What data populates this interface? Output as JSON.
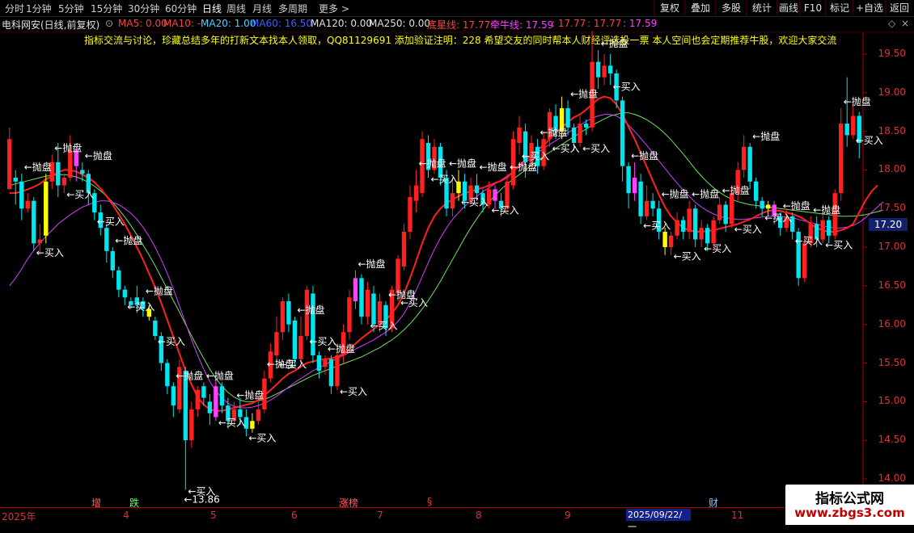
{
  "toolbar": {
    "timeframes": [
      "分时",
      "1分钟",
      "5分钟",
      "15分钟",
      "30分钟",
      "60分钟",
      "日线",
      "周线",
      "月线",
      "多周期",
      "更多 >"
    ],
    "active": "日线",
    "buttons": [
      "复权",
      "叠加",
      "多股",
      "统计",
      "画线",
      "F10",
      "标记",
      "+自选",
      "返回"
    ]
  },
  "stock": {
    "name": "电科网安(日线,前复权)",
    "indicators": [
      {
        "label": "MA5: 0.00",
        "color": "#ff4040"
      },
      {
        "label": "MA10: -",
        "color": "#ff4040"
      },
      {
        "label": "MA20: 1.00",
        "color": "#50d0ff"
      },
      {
        "label": "MA60: 16.50",
        "color": "#4060ff"
      },
      {
        "label": "MA120: 0.00",
        "color": "#e0e0e0"
      },
      {
        "label": "MA250: 0.00",
        "color": "#e0e0e0"
      },
      {
        "label": "底星线: 17.77",
        "color": "#ff4040"
      },
      {
        "label": "牵牛线: 17.59",
        "color": "#ff40ff"
      },
      {
        "label": ": 17.77",
        "color": "#ff4040"
      },
      {
        "label": ": 17.77",
        "color": "#ff4040"
      },
      {
        "label": ": 17.59",
        "color": "#ff40ff"
      }
    ]
  },
  "notice": "指标交流与讨论，珍藏总结多年的打新文本找本人领取，QQ81129691 添加验证注明：228 希望交友的同时帮本人财经评选投一票      本人空间也会定期推荐牛股，欢迎大家交流",
  "price_axis": {
    "labels": [
      "19.50",
      "19.00",
      "18.50",
      "18.00",
      "17.50",
      "17.00",
      "16.50",
      "16.00",
      "15.50",
      "15.00",
      "14.50",
      "14.00"
    ],
    "current": "17.20",
    "low_label": "13.86"
  },
  "dates": [
    "2025年",
    "4",
    "5",
    "6",
    "7",
    "8",
    "9",
    "11"
  ],
  "date_highlight": "2025/09/22/一",
  "events": [
    {
      "label": "增",
      "color": "#ff6060"
    },
    {
      "label": "跌",
      "color": "#60ff60"
    },
    {
      "label": "涨榜",
      "color": "#ff6060"
    },
    {
      "label": "§",
      "color": "#ff3030"
    },
    {
      "label": "财",
      "color": "#80c0ff"
    }
  ],
  "signals": {
    "sell": "←抛盘",
    "buy": "←买入"
  },
  "watermark": {
    "title": "指标公式网",
    "url": "www.zbgs3.com"
  },
  "colors": {
    "up": "#ff2020",
    "down": "#00e5ee",
    "buy_candle": "#ffff00",
    "sell_candle": "#ff40ff",
    "ma_short": "#ff2020",
    "ma_mid": "#d040ff",
    "ma_long": "#70e060"
  },
  "chart_data": {
    "type": "candlestick",
    "ylim": [
      13.7,
      19.8
    ],
    "candles": [
      [
        17.75,
        18.4,
        17.9,
        18.55
      ],
      [
        17.9,
        17.85,
        17.55,
        18.0
      ],
      [
        17.85,
        17.5,
        17.35,
        17.95
      ],
      [
        17.5,
        17.6,
        17.45,
        17.7
      ],
      [
        17.6,
        17.05,
        16.95,
        17.65
      ],
      [
        17.05,
        17.1,
        16.9,
        17.3
      ],
      [
        17.15,
        17.85,
        17.05,
        17.95
      ],
      [
        17.85,
        18.1,
        17.75,
        18.2
      ],
      [
        18.1,
        17.8,
        17.65,
        18.35
      ],
      [
        17.8,
        17.9,
        17.7,
        17.95
      ],
      [
        17.9,
        18.25,
        17.85,
        18.45
      ],
      [
        18.25,
        18.05,
        17.85,
        18.3
      ],
      [
        18.0,
        17.95,
        17.85,
        18.1
      ],
      [
        17.95,
        17.7,
        17.55,
        18.0
      ],
      [
        17.7,
        17.45,
        17.35,
        17.75
      ],
      [
        17.45,
        17.25,
        17.15,
        17.55
      ],
      [
        17.25,
        16.95,
        16.8,
        17.3
      ],
      [
        16.95,
        16.7,
        16.6,
        17.0
      ],
      [
        16.7,
        16.45,
        16.35,
        16.75
      ],
      [
        16.45,
        16.35,
        16.25,
        16.5
      ],
      [
        16.3,
        16.25,
        16.2,
        16.35
      ],
      [
        16.35,
        16.25,
        16.15,
        16.5
      ],
      [
        16.3,
        16.2,
        16.1,
        16.35
      ],
      [
        16.2,
        16.1,
        16.05,
        16.25
      ],
      [
        16.05,
        15.85,
        15.8,
        16.1
      ],
      [
        15.85,
        15.5,
        15.4,
        15.9
      ],
      [
        15.5,
        15.2,
        15.1,
        15.55
      ],
      [
        15.2,
        14.95,
        14.8,
        15.25
      ],
      [
        14.9,
        15.45,
        14.85,
        15.55
      ],
      [
        15.4,
        14.5,
        13.86,
        15.45
      ],
      [
        14.5,
        14.9,
        14.4,
        15.0
      ],
      [
        14.9,
        15.15,
        14.8,
        15.2
      ],
      [
        15.2,
        15.05,
        14.95,
        15.25
      ],
      [
        15.0,
        14.85,
        14.7,
        15.1
      ],
      [
        14.8,
        15.2,
        14.75,
        15.3
      ],
      [
        15.2,
        14.95,
        14.85,
        15.25
      ],
      [
        14.95,
        14.75,
        14.65,
        15.05
      ],
      [
        14.75,
        14.9,
        14.7,
        15.0
      ],
      [
        14.9,
        14.8,
        14.7,
        15.05
      ],
      [
        14.8,
        14.65,
        14.55,
        14.9
      ],
      [
        14.65,
        14.75,
        14.6,
        14.85
      ],
      [
        14.75,
        14.9,
        14.7,
        15.0
      ],
      [
        14.9,
        15.3,
        14.85,
        15.4
      ],
      [
        15.3,
        15.65,
        15.25,
        15.75
      ],
      [
        15.6,
        15.9,
        15.5,
        16.1
      ],
      [
        15.9,
        16.3,
        15.8,
        16.35
      ],
      [
        16.3,
        16.0,
        15.9,
        16.4
      ],
      [
        16.05,
        15.55,
        15.45,
        16.1
      ],
      [
        15.55,
        15.85,
        15.5,
        16.1
      ],
      [
        15.85,
        16.45,
        15.8,
        16.5
      ],
      [
        16.4,
        15.6,
        15.5,
        16.5
      ],
      [
        15.6,
        15.4,
        15.3,
        15.65
      ],
      [
        15.45,
        15.55,
        15.35,
        15.6
      ],
      [
        15.55,
        15.2,
        15.1,
        15.6
      ],
      [
        15.2,
        15.6,
        15.15,
        15.65
      ],
      [
        15.6,
        15.9,
        15.5,
        16.0
      ],
      [
        15.9,
        16.35,
        15.8,
        16.45
      ],
      [
        16.3,
        16.6,
        16.2,
        16.7
      ],
      [
        16.6,
        16.1,
        16.0,
        16.65
      ],
      [
        16.1,
        16.45,
        16.0,
        16.55
      ],
      [
        16.4,
        16.0,
        15.9,
        16.5
      ],
      [
        16.0,
        16.3,
        15.9,
        16.4
      ],
      [
        16.25,
        15.95,
        15.85,
        16.3
      ],
      [
        15.95,
        16.45,
        15.9,
        16.5
      ],
      [
        16.4,
        16.85,
        16.3,
        16.9
      ],
      [
        16.75,
        17.2,
        16.7,
        17.3
      ],
      [
        17.2,
        17.65,
        17.1,
        17.8
      ],
      [
        17.6,
        17.8,
        17.45,
        18.0
      ],
      [
        17.7,
        18.4,
        17.65,
        18.5
      ],
      [
        18.35,
        18.0,
        17.9,
        18.45
      ],
      [
        18.0,
        18.3,
        17.95,
        18.4
      ],
      [
        18.3,
        17.9,
        17.8,
        18.35
      ],
      [
        17.9,
        17.5,
        17.4,
        18.0
      ],
      [
        17.5,
        17.7,
        17.4,
        17.9
      ],
      [
        17.7,
        17.85,
        17.6,
        18.0
      ],
      [
        17.85,
        17.6,
        17.5,
        17.95
      ],
      [
        17.6,
        17.8,
        17.55,
        17.9
      ],
      [
        17.8,
        17.7,
        17.6,
        17.95
      ],
      [
        17.7,
        17.55,
        17.45,
        17.75
      ],
      [
        17.55,
        17.75,
        17.5,
        17.85
      ],
      [
        17.75,
        17.6,
        17.5,
        17.8
      ],
      [
        17.6,
        17.5,
        17.4,
        17.7
      ],
      [
        17.5,
        17.85,
        17.45,
        17.95
      ],
      [
        17.8,
        18.4,
        17.75,
        18.5
      ],
      [
        18.35,
        18.55,
        18.2,
        18.7
      ],
      [
        18.5,
        18.1,
        17.9,
        18.6
      ],
      [
        18.1,
        18.35,
        18.0,
        18.45
      ],
      [
        18.3,
        18.05,
        17.95,
        18.4
      ],
      [
        18.05,
        18.4,
        18.0,
        18.5
      ],
      [
        18.4,
        18.75,
        18.3,
        18.8
      ],
      [
        18.7,
        18.5,
        18.4,
        18.85
      ],
      [
        18.5,
        18.8,
        18.4,
        18.95
      ],
      [
        18.8,
        18.55,
        18.45,
        18.9
      ],
      [
        18.55,
        18.35,
        18.25,
        18.6
      ],
      [
        18.35,
        18.6,
        18.3,
        18.7
      ],
      [
        18.6,
        18.55,
        18.45,
        18.65
      ],
      [
        18.55,
        19.4,
        18.5,
        19.8
      ],
      [
        19.4,
        19.2,
        19.05,
        19.55
      ],
      [
        19.2,
        19.35,
        19.1,
        19.5
      ],
      [
        19.35,
        19.25,
        19.1,
        19.5
      ],
      [
        19.25,
        18.9,
        18.8,
        19.3
      ],
      [
        18.9,
        18.05,
        17.85,
        18.95
      ],
      [
        18.05,
        17.7,
        17.5,
        18.1
      ],
      [
        17.7,
        17.9,
        17.6,
        18.1
      ],
      [
        17.85,
        17.4,
        17.3,
        17.95
      ],
      [
        17.4,
        17.6,
        17.35,
        17.8
      ],
      [
        17.6,
        17.5,
        17.4,
        17.7
      ],
      [
        17.5,
        17.2,
        17.1,
        17.6
      ],
      [
        17.2,
        17.0,
        16.9,
        17.25
      ],
      [
        17.0,
        17.15,
        16.9,
        17.2
      ],
      [
        17.15,
        17.35,
        17.1,
        17.45
      ],
      [
        17.35,
        17.2,
        17.1,
        17.4
      ],
      [
        17.2,
        17.5,
        17.1,
        17.6
      ],
      [
        17.5,
        17.1,
        17.0,
        17.55
      ],
      [
        17.1,
        17.25,
        17.0,
        17.35
      ],
      [
        17.25,
        17.05,
        16.95,
        17.3
      ],
      [
        17.05,
        17.35,
        17.0,
        17.4
      ],
      [
        17.35,
        17.55,
        17.3,
        17.65
      ],
      [
        17.55,
        17.3,
        17.2,
        17.6
      ],
      [
        17.3,
        17.7,
        17.25,
        17.8
      ],
      [
        17.7,
        18.0,
        17.6,
        18.1
      ],
      [
        18.0,
        18.3,
        17.9,
        18.45
      ],
      [
        18.3,
        17.85,
        17.75,
        18.35
      ],
      [
        17.85,
        17.6,
        17.5,
        17.9
      ],
      [
        17.6,
        17.5,
        17.4,
        17.65
      ],
      [
        17.5,
        17.55,
        17.4,
        17.6
      ],
      [
        17.55,
        17.4,
        17.3,
        17.6
      ],
      [
        17.4,
        17.25,
        17.15,
        17.45
      ],
      [
        17.25,
        17.4,
        17.2,
        17.5
      ],
      [
        17.4,
        17.2,
        17.1,
        17.45
      ],
      [
        17.2,
        16.6,
        16.5,
        17.25
      ],
      [
        16.6,
        17.05,
        16.55,
        17.15
      ],
      [
        17.05,
        17.3,
        17.0,
        17.4
      ],
      [
        17.3,
        17.1,
        17.0,
        17.4
      ],
      [
        17.1,
        17.35,
        17.05,
        17.45
      ],
      [
        17.35,
        17.15,
        17.05,
        17.4
      ],
      [
        17.15,
        17.7,
        17.1,
        17.75
      ],
      [
        17.7,
        18.6,
        17.6,
        18.8
      ],
      [
        18.6,
        18.45,
        18.3,
        19.2
      ],
      [
        18.45,
        18.7,
        18.4,
        18.85
      ],
      [
        18.7,
        18.35,
        18.15,
        18.75
      ]
    ],
    "ma_short": [
      17.7,
      17.7,
      17.72,
      17.75,
      17.78,
      17.82,
      17.88,
      17.92,
      17.97,
      18.0,
      18.0,
      17.98,
      17.94,
      17.9,
      17.84,
      17.76,
      17.66,
      17.55,
      17.43,
      17.3,
      17.15,
      17.0,
      16.84,
      16.66,
      16.48,
      16.28,
      16.06,
      15.84,
      15.62,
      15.4,
      15.22,
      15.06,
      14.96,
      14.9,
      14.88,
      14.88,
      14.9,
      14.92,
      14.94,
      14.96,
      14.98,
      15.02,
      15.08,
      15.15,
      15.22,
      15.3,
      15.36,
      15.4,
      15.45,
      15.5,
      15.52,
      15.54,
      15.55,
      15.56,
      15.58,
      15.62,
      15.68,
      15.75,
      15.82,
      15.88,
      15.94,
      16.0,
      16.06,
      16.14,
      16.25,
      16.4,
      16.6,
      16.82,
      17.05,
      17.25,
      17.4,
      17.5,
      17.57,
      17.62,
      17.66,
      17.7,
      17.72,
      17.75,
      17.77,
      17.8,
      17.83,
      17.86,
      17.9,
      17.98,
      18.06,
      18.13,
      18.2,
      18.26,
      18.32,
      18.4,
      18.48,
      18.55,
      18.62,
      18.68,
      18.72,
      18.78,
      18.85,
      18.92,
      18.95,
      18.93,
      18.85,
      18.72,
      18.56,
      18.4,
      18.22,
      18.04,
      17.86,
      17.68,
      17.52,
      17.4,
      17.32,
      17.25,
      17.22,
      17.2,
      17.2,
      17.21,
      17.22,
      17.24,
      17.26,
      17.28,
      17.3,
      17.33,
      17.36,
      17.4,
      17.44,
      17.47,
      17.48,
      17.47,
      17.45,
      17.43,
      17.4,
      17.36,
      17.3,
      17.25,
      17.22,
      17.2,
      17.2,
      17.22,
      17.25,
      17.3,
      17.45,
      17.6,
      17.72,
      17.8
    ],
    "ma_mid": [
      16.5,
      16.6,
      16.72,
      16.85,
      16.96,
      17.05,
      17.14,
      17.22,
      17.3,
      17.36,
      17.42,
      17.47,
      17.52,
      17.55,
      17.58,
      17.6,
      17.6,
      17.58,
      17.55,
      17.5,
      17.44,
      17.36,
      17.26,
      17.14,
      17.0,
      16.84,
      16.66,
      16.46,
      16.24,
      16.02,
      15.8,
      15.6,
      15.42,
      15.26,
      15.14,
      15.05,
      14.98,
      14.94,
      14.92,
      14.92,
      14.93,
      14.95,
      14.98,
      15.02,
      15.07,
      15.13,
      15.19,
      15.25,
      15.3,
      15.35,
      15.4,
      15.44,
      15.48,
      15.52,
      15.56,
      15.6,
      15.64,
      15.68,
      15.72,
      15.76,
      15.8,
      15.85,
      15.9,
      15.96,
      16.04,
      16.14,
      16.28,
      16.44,
      16.62,
      16.8,
      16.97,
      17.12,
      17.25,
      17.36,
      17.45,
      17.53,
      17.6,
      17.66,
      17.72,
      17.77,
      17.82,
      17.87,
      17.92,
      17.98,
      18.04,
      18.1,
      18.16,
      18.22,
      18.28,
      18.33,
      18.38,
      18.43,
      18.48,
      18.53,
      18.58,
      18.63,
      18.67,
      18.7,
      18.72,
      18.72,
      18.7,
      18.65,
      18.58,
      18.5,
      18.41,
      18.32,
      18.22,
      18.12,
      18.02,
      17.92,
      17.83,
      17.74,
      17.66,
      17.58,
      17.52,
      17.47,
      17.43,
      17.4,
      17.38,
      17.37,
      17.36,
      17.36,
      17.37,
      17.38,
      17.39,
      17.4,
      17.4,
      17.4,
      17.39,
      17.38,
      17.36,
      17.34,
      17.32,
      17.3,
      17.28,
      17.26,
      17.25,
      17.25,
      17.26,
      17.28,
      17.32,
      17.38,
      17.45,
      17.52,
      17.59
    ],
    "ma_long": [
      17.8,
      17.82,
      17.84,
      17.86,
      17.88,
      17.9,
      17.92,
      17.93,
      17.94,
      17.94,
      17.93,
      17.91,
      17.88,
      17.84,
      17.79,
      17.73,
      17.66,
      17.58,
      17.49,
      17.39,
      17.28,
      17.16,
      17.03,
      16.9,
      16.76,
      16.61,
      16.46,
      16.31,
      16.16,
      16.0,
      15.85,
      15.7,
      15.56,
      15.42,
      15.3,
      15.2,
      15.12,
      15.06,
      15.02,
      15.0,
      15.0,
      15.01,
      15.03,
      15.06,
      15.1,
      15.14,
      15.18,
      15.22,
      15.26,
      15.3,
      15.34,
      15.37,
      15.4,
      15.43,
      15.46,
      15.49,
      15.52,
      15.55,
      15.58,
      15.62,
      15.66,
      15.7,
      15.75,
      15.8,
      15.86,
      15.93,
      16.01,
      16.1,
      16.2,
      16.31,
      16.43,
      16.56,
      16.7,
      16.84,
      16.98,
      17.12,
      17.25,
      17.37,
      17.48,
      17.58,
      17.67,
      17.75,
      17.82,
      17.88,
      17.94,
      18.0,
      18.06,
      18.12,
      18.18,
      18.23,
      18.28,
      18.33,
      18.38,
      18.43,
      18.48,
      18.53,
      18.58,
      18.62,
      18.66,
      18.7,
      18.72,
      18.74,
      18.74,
      18.72,
      18.69,
      18.65,
      18.6,
      18.54,
      18.47,
      18.39,
      18.3,
      18.21,
      18.11,
      18.01,
      17.92,
      17.84,
      17.77,
      17.71,
      17.66,
      17.62,
      17.59,
      17.57,
      17.55,
      17.54,
      17.53,
      17.52,
      17.51,
      17.5,
      17.49,
      17.48,
      17.47,
      17.46,
      17.45,
      17.44,
      17.43,
      17.42,
      17.41,
      17.4,
      17.4,
      17.4,
      17.41,
      17.42,
      17.44,
      17.46,
      17.48
    ]
  }
}
